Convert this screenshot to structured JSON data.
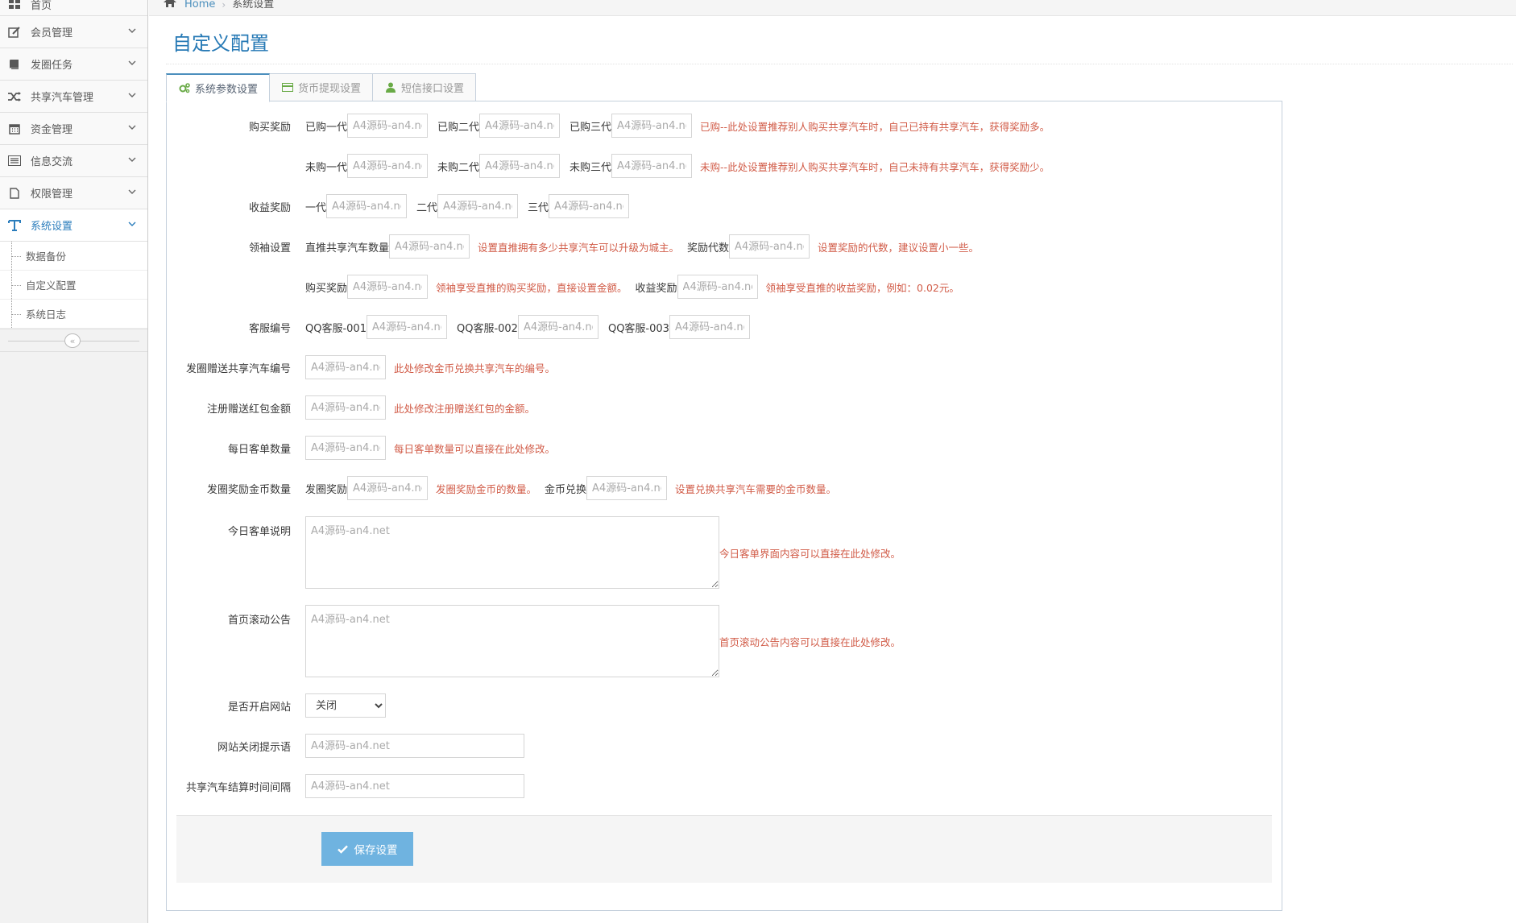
{
  "breadcrumb": {
    "home": "Home",
    "separator": "›",
    "current": "系统设置"
  },
  "sidebar": {
    "items": [
      {
        "label": "首页",
        "icon": "dashboard-icon",
        "active": false
      },
      {
        "label": "会员管理",
        "icon": "edit-icon",
        "active": false
      },
      {
        "label": "发圈任务",
        "icon": "book-icon",
        "active": false
      },
      {
        "label": "共享汽车管理",
        "icon": "shuffle-icon",
        "active": false
      },
      {
        "label": "资金管理",
        "icon": "calendar-icon",
        "active": false
      },
      {
        "label": "信息交流",
        "icon": "list-icon",
        "active": false
      },
      {
        "label": "权限管理",
        "icon": "file-icon",
        "active": false
      },
      {
        "label": "系统设置",
        "icon": "text-icon",
        "active": true
      }
    ],
    "submenu": [
      {
        "label": "数据备份"
      },
      {
        "label": "自定义配置"
      },
      {
        "label": "系统日志"
      }
    ],
    "collapse_symbol": "«"
  },
  "page": {
    "title": "自定义配置"
  },
  "tabs": [
    {
      "label": "系统参数设置",
      "icon": "cogs-icon",
      "active": true,
      "color": "#69aa46"
    },
    {
      "label": "货币提现设置",
      "icon": "credit-card-icon",
      "active": false,
      "color": "#69aa46"
    },
    {
      "label": "短信接口设置",
      "icon": "user-icon",
      "active": false,
      "color": "#69aa46"
    }
  ],
  "placeholder": "A4源码-an4.net",
  "form": {
    "buy_reward": {
      "label": "购买奖励",
      "bought_1": "已购一代",
      "bought_2": "已购二代",
      "bought_3": "已购三代",
      "bought_hint": "已购--此处设置推荐别人购买共享汽车时，自己已持有共享汽车，获得奖励多。",
      "unbought_1": "未购一代",
      "unbought_2": "未购二代",
      "unbought_3": "未购三代",
      "unbought_hint": "未购--此处设置推荐别人购买共享汽车时，自己未持有共享汽车，获得奖励少。"
    },
    "income_reward": {
      "label": "收益奖励",
      "g1": "一代",
      "g2": "二代",
      "g3": "三代"
    },
    "leader": {
      "label": "领袖设置",
      "direct_count": "直推共享汽车数量",
      "direct_hint": "设置直推拥有多少共享汽车可以升级为城主。",
      "reward_gen": "奖励代数",
      "reward_gen_hint": "设置奖励的代数，建议设置小一些。",
      "buy_reward": "购买奖励",
      "buy_hint": "领袖享受直推的购买奖励，直接设置金额。",
      "income_reward": "收益奖励",
      "income_hint": "领袖享受直推的收益奖励，例如：0.02元。"
    },
    "service": {
      "label": "客服编号",
      "s1": "QQ客服-001",
      "s2": "QQ客服-002",
      "s3": "QQ客服-003"
    },
    "gift_car": {
      "label": "发圈赠送共享汽车编号",
      "hint": "此处修改金币兑换共享汽车的编号。"
    },
    "register_gift": {
      "label": "注册赠送红包金额",
      "hint": "此处修改注册赠送红包的金额。"
    },
    "daily_orders": {
      "label": "每日客单数量",
      "hint": "每日客单数量可以直接在此处修改。"
    },
    "circle_reward": {
      "label": "发圈奖励金币数量",
      "reward": "发圈奖励",
      "reward_hint": "发圈奖励金币的数量。",
      "exchange": "金币兑换",
      "exchange_hint": "设置兑换共享汽车需要的金币数量。"
    },
    "today_desc": {
      "label": "今日客单说明",
      "hint": "今日客单界面内容可以直接在此处修改。"
    },
    "announce": {
      "label": "首页滚动公告",
      "hint": "首页滚动公告内容可以直接在此处修改。"
    },
    "site_open": {
      "label": "是否开启网站",
      "value": "关闭"
    },
    "close_msg": {
      "label": "网站关闭提示语"
    },
    "settle_interval": {
      "label": "共享汽车结算时间间隔"
    }
  },
  "actions": {
    "save": "保存设置"
  },
  "colors": {
    "accent": "#2679b5",
    "hint": "#d15b47",
    "button": "#6fb3e0"
  }
}
